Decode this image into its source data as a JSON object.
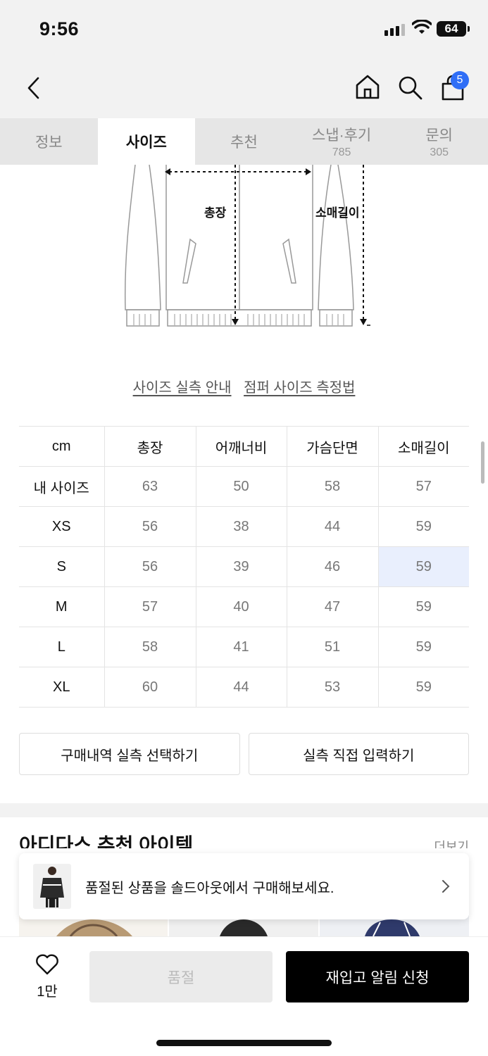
{
  "status_bar": {
    "time": "9:56",
    "battery": "64"
  },
  "header": {
    "cart_count": "5"
  },
  "tabs": [
    {
      "label": "정보",
      "count": ""
    },
    {
      "label": "사이즈",
      "count": ""
    },
    {
      "label": "추천",
      "count": ""
    },
    {
      "label": "스냅·후기",
      "count": "785"
    },
    {
      "label": "문의",
      "count": "305"
    }
  ],
  "diagram": {
    "length_label": "총장",
    "sleeve_label": "소매길이"
  },
  "links": {
    "measure_guide": "사이즈 실측 안내",
    "jumper_method": "점퍼 사이즈 측정법"
  },
  "size_table": {
    "headers": [
      "cm",
      "총장",
      "어깨너비",
      "가슴단면",
      "소매길이"
    ],
    "rows": [
      [
        "내 사이즈",
        "63",
        "50",
        "58",
        "57"
      ],
      [
        "XS",
        "56",
        "38",
        "44",
        "59"
      ],
      [
        "S",
        "56",
        "39",
        "46",
        "59"
      ],
      [
        "M",
        "57",
        "40",
        "47",
        "59"
      ],
      [
        "L",
        "58",
        "41",
        "51",
        "59"
      ],
      [
        "XL",
        "60",
        "44",
        "53",
        "59"
      ]
    ]
  },
  "buttons": {
    "select_history": "구매내역 실측 선택하기",
    "direct_input": "실측 직접 입력하기"
  },
  "recommend": {
    "title": "아디다스 추천 아이템",
    "more": "더보기"
  },
  "toast": {
    "message": "품절된 상품을 솔드아웃에서 구매해보세요."
  },
  "bottom": {
    "likes": "1만",
    "soldout": "품절",
    "restock": "재입고 알림 신청"
  }
}
